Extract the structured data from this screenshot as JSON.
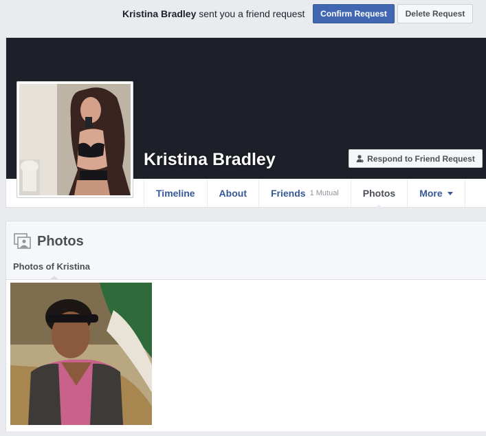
{
  "friend_request": {
    "sender_name": "Kristina Bradley",
    "message": " sent you a friend request",
    "confirm_label": "Confirm Request",
    "delete_label": "Delete Request"
  },
  "profile": {
    "name": "Kristina Bradley",
    "respond_label": "Respond to Friend Request"
  },
  "nav": {
    "timeline": "Timeline",
    "about": "About",
    "friends": "Friends",
    "friends_mutual": "1 Mutual",
    "photos": "Photos",
    "more": "More",
    "active": "photos"
  },
  "photos_section": {
    "title": "Photos",
    "subtitle": "Photos of Kristina"
  },
  "colors": {
    "accent": "#4267b2",
    "link": "#365899",
    "cover": "#1d2028"
  }
}
